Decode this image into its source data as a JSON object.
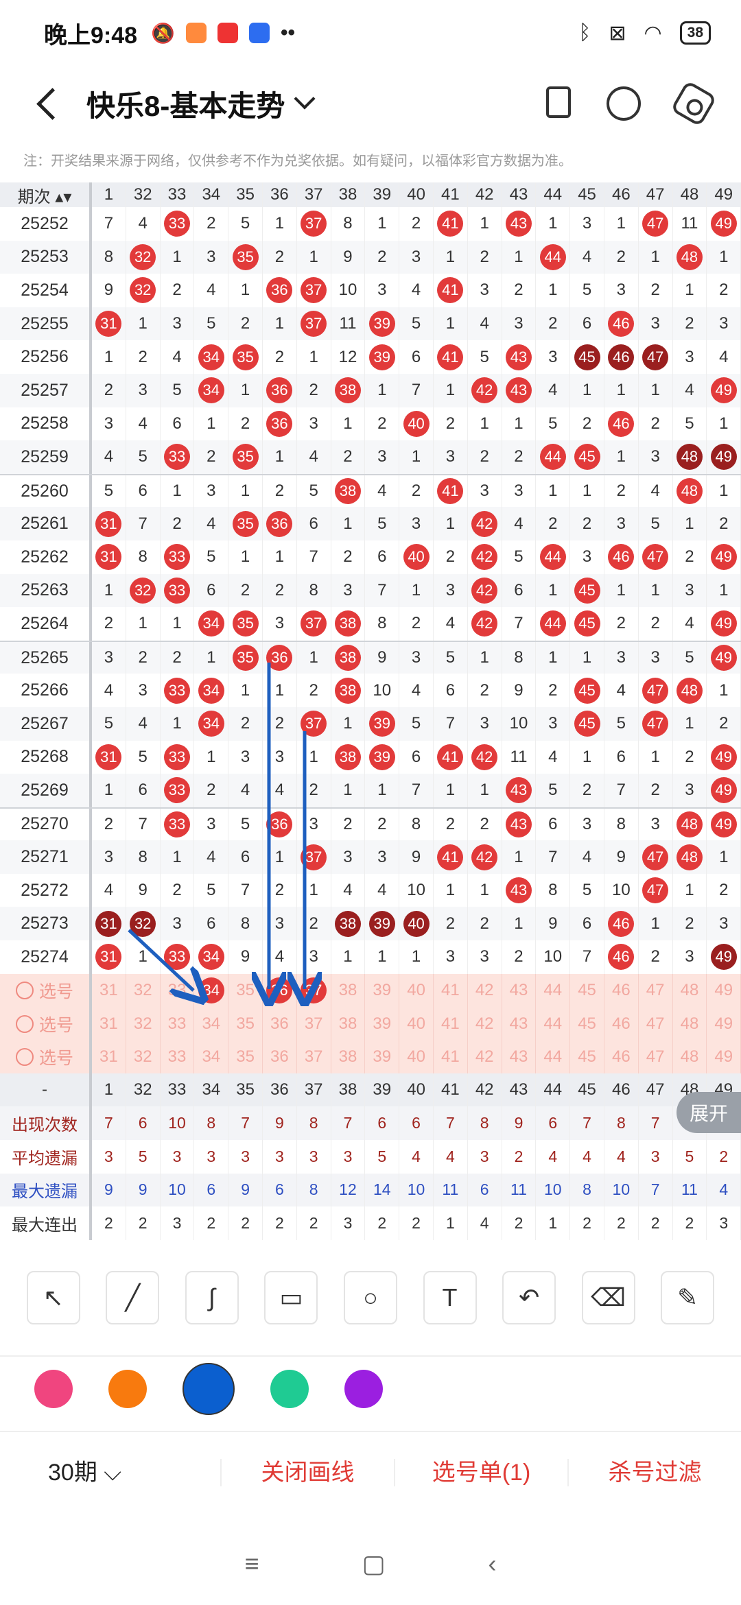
{
  "status": {
    "time": "晚上9:48",
    "battery": "38"
  },
  "nav": {
    "title": "快乐8-基本走势"
  },
  "notice": "注：开奖结果来源于网络，仅供参考不作为兑奖依据。如有疑问，以福体彩官方数据为准。",
  "table": {
    "period_header": "期次",
    "columns": [
      "1",
      "32",
      "33",
      "34",
      "35",
      "36",
      "37",
      "38",
      "39",
      "40",
      "41",
      "42",
      "43",
      "44",
      "45",
      "46",
      "47",
      "48",
      "49"
    ],
    "rows": [
      {
        "p": "25252",
        "v": [
          "7",
          "4",
          "33",
          "2",
          "5",
          "1",
          "37",
          "8",
          "1",
          "2",
          "41",
          "1",
          "43",
          "1",
          "3",
          "1",
          "47",
          "11",
          "49"
        ],
        "b": [
          2,
          6,
          10,
          12,
          16,
          18
        ]
      },
      {
        "p": "25253",
        "v": [
          "8",
          "32",
          "1",
          "3",
          "35",
          "2",
          "1",
          "9",
          "2",
          "3",
          "1",
          "2",
          "1",
          "44",
          "4",
          "2",
          "1",
          "48",
          "1"
        ],
        "b": [
          1,
          4,
          13,
          17
        ]
      },
      {
        "p": "25254",
        "v": [
          "9",
          "32",
          "2",
          "4",
          "1",
          "36",
          "37",
          "10",
          "3",
          "4",
          "41",
          "3",
          "2",
          "1",
          "5",
          "3",
          "2",
          "1",
          "2"
        ],
        "b": [
          1,
          5,
          6,
          10
        ]
      },
      {
        "p": "25255",
        "v": [
          "31",
          "1",
          "3",
          "5",
          "2",
          "1",
          "37",
          "11",
          "39",
          "5",
          "1",
          "4",
          "3",
          "2",
          "6",
          "46",
          "3",
          "2",
          "3"
        ],
        "b": [
          0,
          6,
          8,
          15
        ]
      },
      {
        "p": "25256",
        "v": [
          "1",
          "2",
          "4",
          "34",
          "35",
          "2",
          "1",
          "12",
          "39",
          "6",
          "41",
          "5",
          "43",
          "3",
          "45",
          "46",
          "47",
          "3",
          "4"
        ],
        "b": [
          3,
          4,
          8,
          10,
          12
        ],
        "d": [
          14,
          15,
          16
        ]
      },
      {
        "p": "25257",
        "v": [
          "2",
          "3",
          "5",
          "34",
          "1",
          "36",
          "2",
          "38",
          "1",
          "7",
          "1",
          "42",
          "43",
          "4",
          "1",
          "1",
          "1",
          "4",
          "49"
        ],
        "b": [
          3,
          5,
          7,
          11,
          12,
          18
        ]
      },
      {
        "p": "25258",
        "v": [
          "3",
          "4",
          "6",
          "1",
          "2",
          "36",
          "3",
          "1",
          "2",
          "40",
          "2",
          "1",
          "1",
          "5",
          "2",
          "46",
          "2",
          "5",
          "1"
        ],
        "b": [
          5,
          9,
          15
        ]
      },
      {
        "p": "25259",
        "v": [
          "4",
          "5",
          "33",
          "2",
          "35",
          "1",
          "4",
          "2",
          "3",
          "1",
          "3",
          "2",
          "2",
          "44",
          "45",
          "1",
          "3",
          "48",
          "49"
        ],
        "b": [
          2,
          4,
          13,
          14
        ],
        "d": [
          17,
          18
        ]
      },
      {
        "p": "25260",
        "v": [
          "5",
          "6",
          "1",
          "3",
          "1",
          "2",
          "5",
          "38",
          "4",
          "2",
          "41",
          "3",
          "3",
          "1",
          "1",
          "2",
          "4",
          "48",
          "1"
        ],
        "b": [
          7,
          10,
          17
        ]
      },
      {
        "p": "25261",
        "v": [
          "31",
          "7",
          "2",
          "4",
          "35",
          "36",
          "6",
          "1",
          "5",
          "3",
          "1",
          "42",
          "4",
          "2",
          "2",
          "3",
          "5",
          "1",
          "2"
        ],
        "b": [
          0,
          4,
          5,
          11
        ]
      },
      {
        "p": "25262",
        "v": [
          "31",
          "8",
          "33",
          "5",
          "1",
          "1",
          "7",
          "2",
          "6",
          "40",
          "2",
          "42",
          "5",
          "44",
          "3",
          "46",
          "47",
          "2",
          "49"
        ],
        "b": [
          0,
          2,
          9,
          11,
          13,
          15,
          16,
          18
        ]
      },
      {
        "p": "25263",
        "v": [
          "1",
          "32",
          "33",
          "6",
          "2",
          "2",
          "8",
          "3",
          "7",
          "1",
          "3",
          "42",
          "6",
          "1",
          "45",
          "1",
          "1",
          "3",
          "1"
        ],
        "b": [
          1,
          2,
          11,
          14
        ]
      },
      {
        "p": "25264",
        "v": [
          "2",
          "1",
          "1",
          "34",
          "35",
          "3",
          "37",
          "38",
          "8",
          "2",
          "4",
          "42",
          "7",
          "44",
          "45",
          "2",
          "2",
          "4",
          "49"
        ],
        "b": [
          3,
          4,
          6,
          7,
          11,
          13,
          14,
          18
        ]
      },
      {
        "p": "25265",
        "v": [
          "3",
          "2",
          "2",
          "1",
          "35",
          "36",
          "1",
          "38",
          "9",
          "3",
          "5",
          "1",
          "8",
          "1",
          "1",
          "3",
          "3",
          "5",
          "49"
        ],
        "b": [
          4,
          5,
          7,
          18
        ]
      },
      {
        "p": "25266",
        "v": [
          "4",
          "3",
          "33",
          "34",
          "1",
          "1",
          "2",
          "38",
          "10",
          "4",
          "6",
          "2",
          "9",
          "2",
          "45",
          "4",
          "47",
          "48",
          "1"
        ],
        "b": [
          2,
          3,
          7,
          14,
          16,
          17
        ]
      },
      {
        "p": "25267",
        "v": [
          "5",
          "4",
          "1",
          "34",
          "2",
          "2",
          "37",
          "1",
          "39",
          "5",
          "7",
          "3",
          "10",
          "3",
          "45",
          "5",
          "47",
          "1",
          "2"
        ],
        "b": [
          3,
          6,
          8,
          14,
          16
        ]
      },
      {
        "p": "25268",
        "v": [
          "31",
          "5",
          "33",
          "1",
          "3",
          "3",
          "1",
          "38",
          "39",
          "6",
          "41",
          "42",
          "11",
          "4",
          "1",
          "6",
          "1",
          "2",
          "49"
        ],
        "b": [
          0,
          2,
          7,
          8,
          10,
          11,
          18
        ]
      },
      {
        "p": "25269",
        "v": [
          "1",
          "6",
          "33",
          "2",
          "4",
          "4",
          "2",
          "1",
          "1",
          "7",
          "1",
          "1",
          "43",
          "5",
          "2",
          "7",
          "2",
          "3",
          "49"
        ],
        "b": [
          2,
          12,
          18
        ]
      },
      {
        "p": "25270",
        "v": [
          "2",
          "7",
          "33",
          "3",
          "5",
          "36",
          "3",
          "2",
          "2",
          "8",
          "2",
          "2",
          "43",
          "6",
          "3",
          "8",
          "3",
          "48",
          "49"
        ],
        "b": [
          2,
          5,
          12,
          17,
          18
        ]
      },
      {
        "p": "25271",
        "v": [
          "3",
          "8",
          "1",
          "4",
          "6",
          "1",
          "37",
          "3",
          "3",
          "9",
          "41",
          "42",
          "1",
          "7",
          "4",
          "9",
          "47",
          "48",
          "1"
        ],
        "b": [
          6,
          10,
          11,
          16,
          17
        ]
      },
      {
        "p": "25272",
        "v": [
          "4",
          "9",
          "2",
          "5",
          "7",
          "2",
          "1",
          "4",
          "4",
          "10",
          "1",
          "1",
          "43",
          "8",
          "5",
          "10",
          "47",
          "1",
          "2"
        ],
        "b": [
          12,
          16
        ]
      },
      {
        "p": "25273",
        "v": [
          "31",
          "32",
          "3",
          "6",
          "8",
          "3",
          "2",
          "38",
          "39",
          "40",
          "2",
          "2",
          "1",
          "9",
          "6",
          "46",
          "1",
          "2",
          "3"
        ],
        "b": [
          15
        ],
        "d": [
          0,
          1,
          7,
          8,
          9
        ]
      },
      {
        "p": "25274",
        "v": [
          "31",
          "1",
          "33",
          "34",
          "9",
          "4",
          "3",
          "1",
          "1",
          "1",
          "3",
          "3",
          "2",
          "10",
          "7",
          "46",
          "2",
          "3",
          "49"
        ],
        "b": [
          0,
          2,
          3,
          15
        ],
        "d": [
          18
        ]
      }
    ],
    "select_label": "选号",
    "select_rows": [
      {
        "v": [
          "31",
          "32",
          "33",
          "34",
          "35",
          "36",
          "37",
          "38",
          "39",
          "40",
          "41",
          "42",
          "43",
          "44",
          "45",
          "46",
          "47",
          "48",
          "49"
        ],
        "b": [
          3,
          5,
          6
        ]
      },
      {
        "v": [
          "31",
          "32",
          "33",
          "34",
          "35",
          "36",
          "37",
          "38",
          "39",
          "40",
          "41",
          "42",
          "43",
          "44",
          "45",
          "46",
          "47",
          "48",
          "49"
        ],
        "b": []
      },
      {
        "v": [
          "31",
          "32",
          "33",
          "34",
          "35",
          "36",
          "37",
          "38",
          "39",
          "40",
          "41",
          "42",
          "43",
          "44",
          "45",
          "46",
          "47",
          "48",
          "49"
        ],
        "b": []
      }
    ],
    "footer_header": {
      "p": "-",
      "v": [
        "1",
        "32",
        "33",
        "34",
        "35",
        "36",
        "37",
        "38",
        "39",
        "40",
        "41",
        "42",
        "43",
        "44",
        "45",
        "46",
        "47",
        "48",
        "49"
      ]
    },
    "stats": [
      {
        "label": "出现次数",
        "cls": "red",
        "v": [
          "7",
          "6",
          "10",
          "8",
          "7",
          "9",
          "8",
          "7",
          "6",
          "6",
          "7",
          "8",
          "9",
          "6",
          "7",
          "8",
          "7",
          "",
          ""
        ]
      },
      {
        "label": "平均遗漏",
        "cls": "red",
        "v": [
          "3",
          "5",
          "3",
          "3",
          "3",
          "3",
          "3",
          "3",
          "5",
          "4",
          "4",
          "3",
          "2",
          "4",
          "4",
          "4",
          "3",
          "5",
          "2"
        ]
      },
      {
        "label": "最大遗漏",
        "cls": "blue",
        "v": [
          "9",
          "9",
          "10",
          "6",
          "9",
          "6",
          "8",
          "12",
          "14",
          "10",
          "11",
          "6",
          "11",
          "10",
          "8",
          "10",
          "7",
          "11",
          "4"
        ]
      },
      {
        "label": "最大连出",
        "cls": "dark",
        "v": [
          "2",
          "2",
          "3",
          "2",
          "2",
          "2",
          "2",
          "3",
          "2",
          "2",
          "1",
          "4",
          "2",
          "1",
          "2",
          "2",
          "2",
          "2",
          "3"
        ]
      }
    ],
    "expand_label": "展开"
  },
  "colors": [
    "#f0457f",
    "#f87a0e",
    "#0b5fcf",
    "#1fcb93",
    "#9b1fe0"
  ],
  "footer": {
    "period": "30期",
    "close_draw": "关闭画线",
    "select_list": "选号单(1)",
    "kill_filter": "杀号过滤"
  }
}
